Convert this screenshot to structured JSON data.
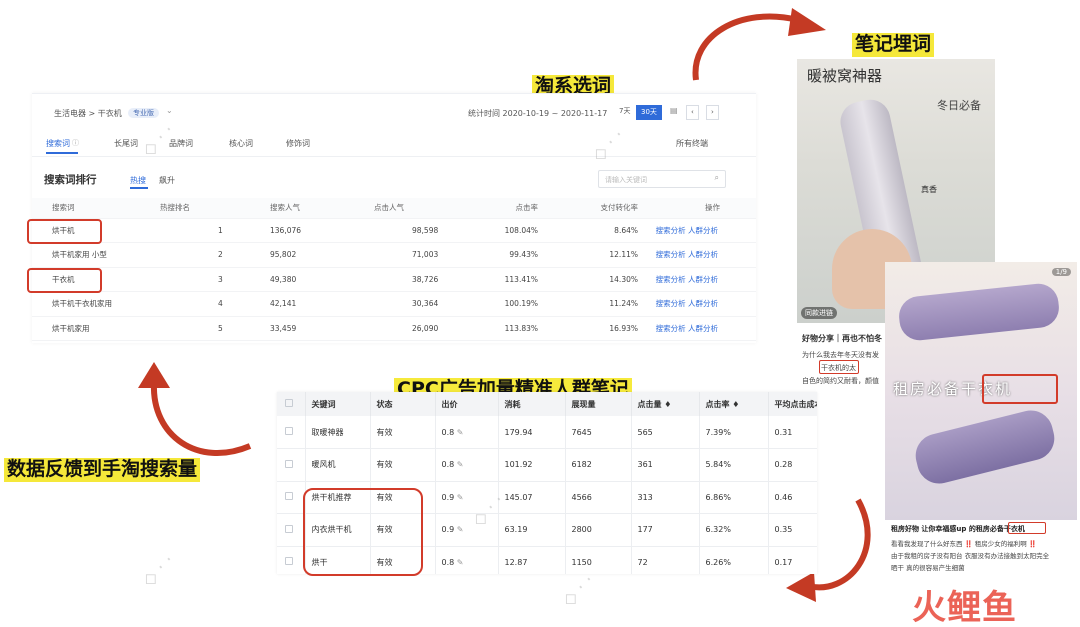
{
  "labels": {
    "taoxi": "淘系选词",
    "note_words": "笔记埋词",
    "cpc": "CPC广告加量精准人群笔记",
    "feedback": "数据反馈到手淘搜索量"
  },
  "taobao": {
    "breadcrumb": "生活电器 > 干衣机",
    "edition": "专业版",
    "stat_time": "统计时间 2020-10-19 ~ 2020-11-17",
    "btn_7d": "7天",
    "btn_30d": "30天",
    "tabs": [
      "搜索词",
      "长尾词",
      "品牌词",
      "核心词",
      "修饰词"
    ],
    "terminal": "所有终端",
    "section_title": "搜索词排行",
    "sub_tabs": [
      "热搜",
      "飙升"
    ],
    "search_placeholder": "请输入关键词",
    "headers": [
      "搜索词",
      "热搜排名",
      "搜索人气",
      "点击人气",
      "点击率",
      "支付转化率",
      "操作"
    ],
    "rows": [
      {
        "word": "烘干机",
        "rank": "1",
        "search": "136,076",
        "click": "98,598",
        "ctr": "108.04%",
        "cvr": "8.64%",
        "op1": "搜索分析",
        "op2": "人群分析"
      },
      {
        "word": "烘干机家用 小型",
        "rank": "2",
        "search": "95,802",
        "click": "71,003",
        "ctr": "99.43%",
        "cvr": "12.11%",
        "op1": "搜索分析",
        "op2": "人群分析"
      },
      {
        "word": "干衣机",
        "rank": "3",
        "search": "49,380",
        "click": "38,726",
        "ctr": "113.41%",
        "cvr": "14.30%",
        "op1": "搜索分析",
        "op2": "人群分析"
      },
      {
        "word": "烘干机干衣机家用",
        "rank": "4",
        "search": "42,141",
        "click": "30,364",
        "ctr": "100.19%",
        "cvr": "11.24%",
        "op1": "搜索分析",
        "op2": "人群分析"
      },
      {
        "word": "烘干机家用",
        "rank": "5",
        "search": "33,459",
        "click": "26,090",
        "ctr": "113.83%",
        "cvr": "16.93%",
        "op1": "搜索分析",
        "op2": "人群分析"
      }
    ]
  },
  "cpc": {
    "headers": [
      "关键词",
      "状态",
      "出价",
      "消耗",
      "展现量",
      "点击量 ♦",
      "点击率 ♦",
      "平均点击成本"
    ],
    "rows": [
      {
        "kw": "取暖神器",
        "status": "有效",
        "bid": "0.8",
        "cost": "179.94",
        "imp": "7645",
        "clicks": "565",
        "ctr": "7.39%",
        "cpc": "0.31"
      },
      {
        "kw": "暖风机",
        "status": "有效",
        "bid": "0.8",
        "cost": "101.92",
        "imp": "6182",
        "clicks": "361",
        "ctr": "5.84%",
        "cpc": "0.28"
      },
      {
        "kw": "烘干机推荐",
        "status": "有效",
        "bid": "0.9",
        "cost": "145.07",
        "imp": "4566",
        "clicks": "313",
        "ctr": "6.86%",
        "cpc": "0.46"
      },
      {
        "kw": "内衣烘干机",
        "status": "有效",
        "bid": "0.9",
        "cost": "63.19",
        "imp": "2800",
        "clicks": "177",
        "ctr": "6.32%",
        "cpc": "0.35"
      },
      {
        "kw": "烘干",
        "status": "有效",
        "bid": "0.8",
        "cost": "12.87",
        "imp": "1150",
        "clicks": "72",
        "ctr": "6.26%",
        "cpc": "0.17"
      }
    ]
  },
  "note1": {
    "title": "暖被窝神器",
    "sticker": "冬日必备",
    "tag": "真香",
    "source": "同款进链",
    "caption1": "好物分享｜再也不怕冬",
    "caption2": "为什么我去年冬天没有发",
    "caption3": "干衣机的太",
    "caption4": "自色的简约又耐看，颜值"
  },
  "note2": {
    "counter": "1/9",
    "overlay": "租房必备干衣机",
    "caption1": "租房好物 让你幸福感up 的租房必备干衣机",
    "caption2": "看看我发现了什么好东西 ‼️ 租房少女的福利啊 ‼️",
    "caption3": "由于我租的房子没有阳台 衣服没有办法接触到太阳完全",
    "caption4": "晒干 真的很容易产生细菌"
  },
  "brand": "火鲤鱼",
  "colors": {
    "accent_red": "#d23b2a",
    "highlight": "#f5e83a",
    "link_blue": "#2f6bd9",
    "brand_red": "#e8483a"
  }
}
